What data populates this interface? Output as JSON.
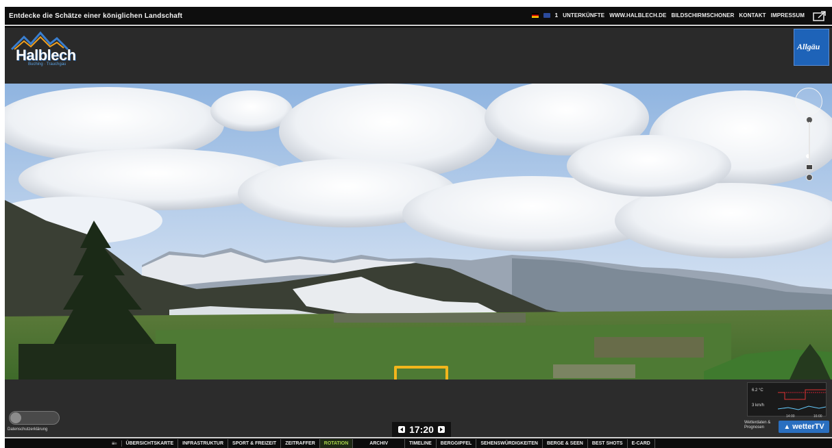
{
  "topbar": {
    "tagline": "Entdecke die Schätze einer königlichen Landschaft",
    "fb_number": "1",
    "links": [
      "UNTERKÜNFTE",
      "WWW.HALBLECH.DE",
      "BILDSCHIRMSCHONER",
      "KONTAKT",
      "IMPRESSUM"
    ]
  },
  "header": {
    "logo_text": "Halblech",
    "logo_subtext": "Buching · Trauchgau",
    "badge_text": "Allgäu"
  },
  "bottom": {
    "data_protection_label": "Datenschutzerklärung",
    "time": "17:20",
    "weather": {
      "temp_label": "6.2 °C",
      "wind_label": "3 km/h",
      "tick1": "14:00",
      "tick2": "16:00",
      "forecast_label": "Wetterdaten & Prognosen",
      "brand": "wetterTV"
    }
  },
  "nav": {
    "items": [
      "ÜBERSICHTSKARTE",
      "INFRASTRUKTUR",
      "SPORT & FREIZEIT",
      "ZEITRAFFER",
      "ROTATION",
      "ARCHIV",
      "TIMELINE",
      "BERGGIPFEL",
      "SEHENSWÜRDIGKEITEN",
      "BERGE & SEEN",
      "BEST SHOTS",
      "E-CARD"
    ],
    "active": "ROTATION"
  },
  "colors": {
    "arrow": "#f2b61c",
    "accent_blue": "#1e63b8",
    "active_nav": "#a9d44b"
  }
}
